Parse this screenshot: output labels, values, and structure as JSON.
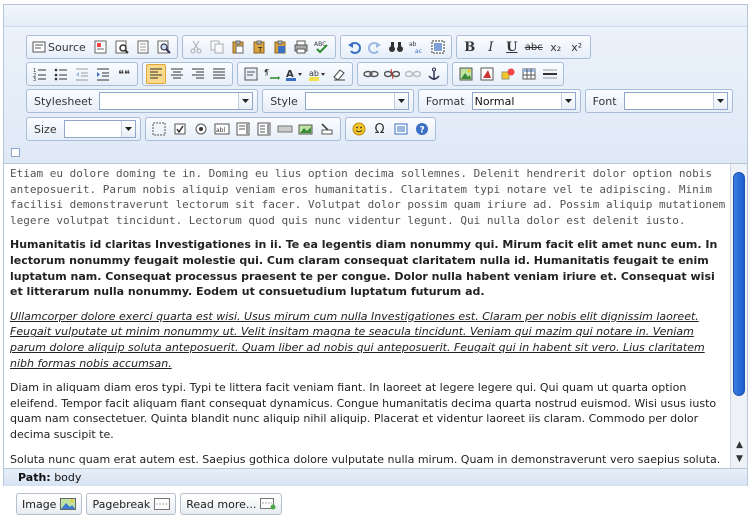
{
  "toolbar": {
    "source_label": "Source",
    "stylesheet_label": "Stylesheet",
    "stylesheet_value": "",
    "style_label": "Style",
    "style_value": "",
    "format_label": "Format",
    "format_value": "Normal",
    "font_label": "Font",
    "font_value": "",
    "size_label": "Size",
    "size_value": "",
    "bold_glyph": "B",
    "italic_glyph": "I",
    "underline_glyph": "U",
    "strike_glyph": "abc",
    "sub_glyph": "x₂",
    "sup_glyph": "x²",
    "omega_glyph": "Ω",
    "quote_glyph": "❝❝"
  },
  "content": {
    "mono_paragraph": "Etiam eu dolore doming te in. Doming eu lius option decima sollemnes. Delenit hendrerit dolor option nobis anteposuerit. Parum nobis aliquip veniam eros humanitatis. Claritatem typi notare vel te adipiscing. Minim facilisi demonstraverunt lectorum sit facer. Volutpat dolor possim quam iriure ad. Possim aliquip mutationem legere volutpat tincidunt. Lectorum quod quis nunc videntur legunt. Qui nulla dolor est delenit iusto.",
    "bold_paragraph": "Humanitatis id claritas Investigationes in ii. Te ea legentis diam nonummy qui. Mirum facit elit amet nunc eum. In lectorum nonummy feugait molestie qui. Cum claram consequat claritatem nulla id. Humanitatis feugait te enim luptatum nam. Consequat processus praesent te per congue. Dolor nulla habent veniam iriure et. Consequat wisi et litterarum nulla nonummy. Eodem ut consuetudium luptatum futurum ad.",
    "italic_paragraph": "Ullamcorper dolore exerci quarta est wisi. Usus mirum cum nulla Investigationes est. Claram per nobis elit dignissim laoreet. Feugait vulputate ut minim nonummy ut. Velit insitam magna te seacula tincidunt. Veniam qui mazim qui notare in. Veniam parum dolore aliquip soluta anteposuerit. Quam liber ad nobis qui anteposuerit. Feugait qui in habent sit vero. Lius claritatem nibh formas nobis accumsan.",
    "normal_paragraph": "Diam in aliquam diam eros typi. Typi te littera facit veniam fiant. In laoreet at legere legere qui. Qui quam ut quarta option eleifend. Tempor facit aliquam fiant consequat dynamicus. Congue humanitatis decima quarta nostrud euismod. Wisi usus iusto quam nam consectetuer. Quinta blandit nunc aliquip nihil aliquip. Placerat et videntur laoreet iis claram. Commodo per dolor decima suscipit te.",
    "last_paragraph": "Soluta nunc quam erat autem est. Saepius gothica dolore vulputate nulla mirum. Quam in demonstraverunt vero saepius soluta."
  },
  "pathbar": {
    "label": "Path:",
    "value": "body"
  },
  "bottom_buttons": {
    "image_label": "Image",
    "pagebreak_label": "Pagebreak",
    "readmore_label": "Read more..."
  },
  "colors": {
    "accent_scroll": "#1a5fcf",
    "toolbar_bg": "#e3ecf8",
    "active_button": "#f9d98a"
  }
}
